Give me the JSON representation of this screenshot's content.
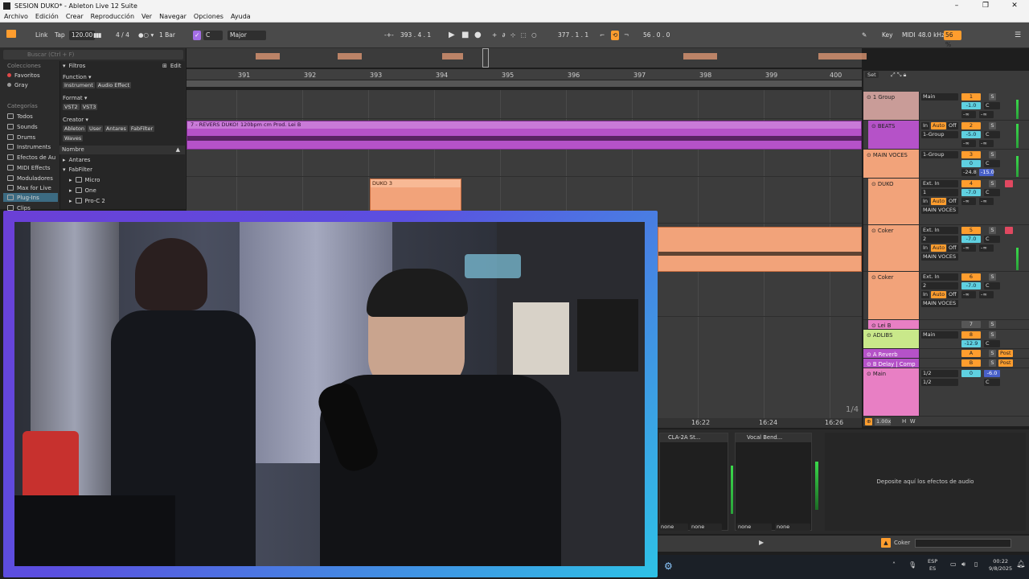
{
  "window": {
    "title": "SESION DUKO* - Ableton Live 12 Suite",
    "controls": [
      "–",
      "❐",
      "✕"
    ]
  },
  "menu": [
    "Archivo",
    "Edición",
    "Crear",
    "Reproducción",
    "Ver",
    "Navegar",
    "Opciones",
    "Ayuda"
  ],
  "control_bar": {
    "link": "Link",
    "tap": "Tap",
    "tempo": "120.00",
    "signature": "4 / 4",
    "quantize": "1 Bar",
    "key": "C",
    "scale": "Major",
    "position": "393 . 4 . 1",
    "loop_start": "377 . 1 . 1",
    "loop_length": "56 . 0 . 0",
    "key_label": "Key",
    "midi_label": "MIDI",
    "sample_rate": "48.0 kHz",
    "cpu": "56 %"
  },
  "browser": {
    "search_placeholder": "Buscar (Ctrl + F)",
    "collections_heading": "Colecciones",
    "collections": [
      {
        "label": "Favoritos",
        "color": "#e04848"
      },
      {
        "label": "Gray",
        "color": "#9a9a9a"
      }
    ],
    "categories_heading": "Categorías",
    "categories": [
      "Todos",
      "Sounds",
      "Drums",
      "Instruments",
      "Efectos de Au",
      "MIDI Effects",
      "Moduladores",
      "Max for Live",
      "Plug-Ins",
      "Clips"
    ],
    "filters_label": "Filtros",
    "edit_label": "Edit",
    "function_label": "Function ▾",
    "function_tags": [
      "Instrument",
      "Audio Effect"
    ],
    "format_label": "Format ▾",
    "format_tags": [
      "VST2",
      "VST3"
    ],
    "creator_label": "Creator ▾",
    "creator_tags": [
      "Ableton",
      "User",
      "Antares",
      "FabFilter",
      "Waves"
    ],
    "name_header": "Nombre",
    "tree": [
      "Antares",
      "FabFilter",
      "Micro",
      "One",
      "Pro-C 2"
    ]
  },
  "ruler": {
    "bars": [
      "391",
      "392",
      "393",
      "394",
      "395",
      "396",
      "397",
      "398",
      "399",
      "400"
    ],
    "time_labels": [
      "16:22",
      "16:24",
      "16:26"
    ]
  },
  "clips": {
    "revers": "7 - REVERS DUKO! 120bpm cm Prod. Lei B",
    "duko3": "DUKO 3"
  },
  "set_label": "Set",
  "page_indicator": "1/4",
  "zoom": "1.00x",
  "mixer": [
    {
      "name": "1 Group",
      "color": "#c99c98",
      "routing": "Main",
      "num": "1",
      "vol": "-1.0",
      "pan": "C"
    },
    {
      "name": "BEATS",
      "color": "#b552c8",
      "input": "In",
      "auto": "Auto",
      "off": "Off",
      "routing": "1-Group",
      "num": "2",
      "vol": "-5.0",
      "pan": "C"
    },
    {
      "name": "MAIN VOCES",
      "color": "#f2a37a",
      "routing": "1-Group",
      "num": "3",
      "vol": "0",
      "pan": "C",
      "peak1": "-24.8",
      "peak2": "-15.0"
    },
    {
      "name": "DUKO",
      "color": "#f2a37a",
      "input": "Ext. In",
      "ch": "1",
      "auto": "Auto",
      "off": "Off",
      "routing": "MAIN VOCES",
      "num": "4",
      "vol": "-7.0",
      "pan": "C"
    },
    {
      "name": "Coker",
      "color": "#f2a37a",
      "input": "Ext. In",
      "ch": "2",
      "auto": "Auto",
      "off": "Off",
      "routing": "MAIN VOCES",
      "num": "5",
      "vol": "-7.0",
      "pan": "C"
    },
    {
      "name": "Coker",
      "color": "#f2a37a",
      "input": "Ext. In",
      "ch": "2",
      "auto": "Auto",
      "off": "Off",
      "routing": "MAIN VOCES",
      "num": "6",
      "vol": "-7.0",
      "pan": "C"
    },
    {
      "name": "Lei B",
      "color": "#e87fc4",
      "num": "7"
    },
    {
      "name": "ADLIBS",
      "color": "#c9e88a",
      "routing": "Main",
      "num": "8",
      "vol": "-12.9",
      "pan": "C"
    },
    {
      "name": "A Reverb",
      "color": "#b552c8",
      "num": "A",
      "post": "Post"
    },
    {
      "name": "B Delay | Comp",
      "color": "#b552c8",
      "num": "B",
      "post": "Post"
    },
    {
      "name": "Main",
      "color": "#e87fc4",
      "routing": "1/2",
      "routing2": "1/2",
      "num": "0",
      "vol": "-6.0",
      "pan": "C"
    }
  ],
  "solo_label": "S",
  "neg_inf": "-∞",
  "devices": [
    {
      "name": "CLA-2A St...",
      "left": "none",
      "right": "none"
    },
    {
      "name": "Vocal Bend...",
      "left": "none",
      "right": "none"
    }
  ],
  "device_drop_hint": "Deposite aquí los efectos de audio",
  "selected_track": "Coker",
  "taskbar": {
    "lang": "ESP",
    "region": "ES",
    "time": "00:22",
    "date": "9/8/2025"
  }
}
